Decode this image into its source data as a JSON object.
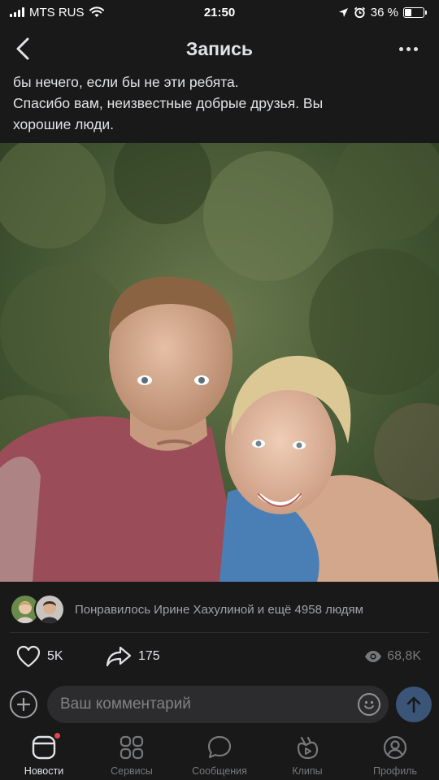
{
  "status_bar": {
    "carrier": "MTS RUS",
    "time": "21:50",
    "battery": "36 %",
    "battery_level": 0.36
  },
  "header": {
    "title": "Запись"
  },
  "post": {
    "lines": [
      "бы нечего, если бы не эти ребята.",
      "Спасибо вам, неизвестные добрые друзья. Вы",
      "хорошие люди."
    ]
  },
  "likes": {
    "text": "Понравилось Ирине Хахулиной и ещё 4958 людям"
  },
  "actions": {
    "likes_count": "5K",
    "shares_count": "175",
    "views_count": "68,8K"
  },
  "comment": {
    "placeholder": "Ваш комментарий"
  },
  "tabs": [
    {
      "label": "Новости",
      "icon": "news-icon",
      "active": true
    },
    {
      "label": "Сервисы",
      "icon": "services-icon",
      "active": false
    },
    {
      "label": "Сообщения",
      "icon": "messages-icon",
      "active": false
    },
    {
      "label": "Клипы",
      "icon": "clips-icon",
      "active": false
    },
    {
      "label": "Профиль",
      "icon": "profile-icon",
      "active": false
    }
  ],
  "colors": {
    "background": "#19191a",
    "text_primary": "#e1e3e6",
    "text_secondary": "#a0a3a8",
    "send_button": "#3a5577",
    "notification": "#e64646"
  }
}
